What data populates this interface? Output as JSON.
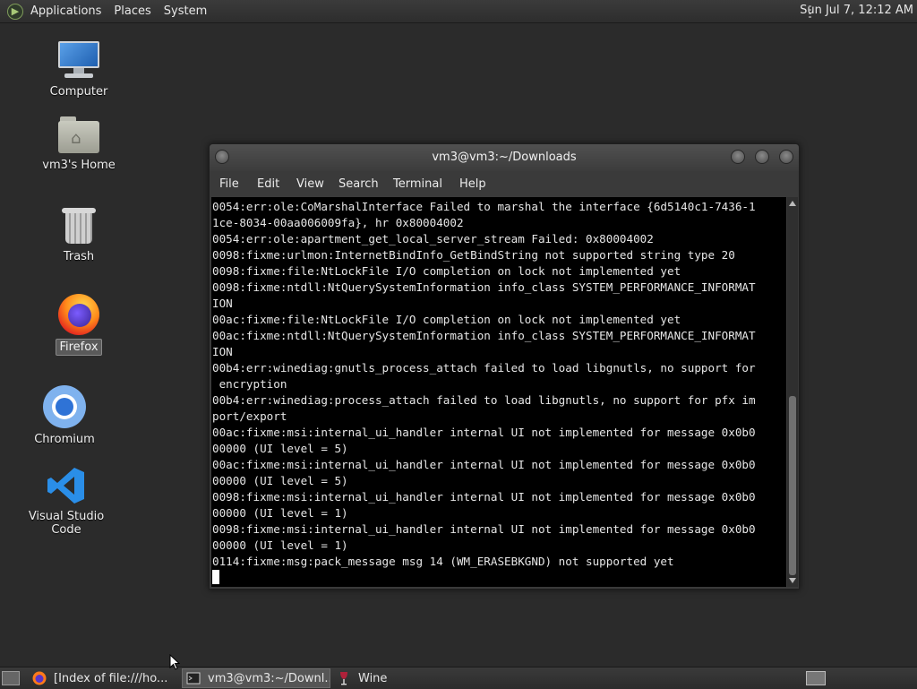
{
  "top_panel": {
    "menus": [
      "Applications",
      "Places",
      "System"
    ],
    "clock": "Sun Jul  7, 12:12 AM"
  },
  "desktop": {
    "icons": [
      {
        "label": "Computer",
        "icon": "computer-icon"
      },
      {
        "label": "vm3's Home",
        "icon": "home-folder-icon"
      },
      {
        "label": "Trash",
        "icon": "trash-icon"
      },
      {
        "label": "Firefox",
        "icon": "firefox-icon",
        "selected": true
      },
      {
        "label": "Chromium",
        "icon": "chromium-icon"
      },
      {
        "label": "Visual Studio Code",
        "icon": "vscode-icon"
      }
    ]
  },
  "terminal": {
    "title": "vm3@vm3:~/Downloads",
    "menu": [
      "File",
      "Edit",
      "View",
      "Search",
      "Terminal",
      "Help"
    ],
    "lines": [
      "0054:err:ole:CoMarshalInterface Failed to marshal the interface {6d5140c1-7436-1",
      "1ce-8034-00aa006009fa}, hr 0x80004002",
      "0054:err:ole:apartment_get_local_server_stream Failed: 0x80004002",
      "0098:fixme:urlmon:InternetBindInfo_GetBindString not supported string type 20",
      "0098:fixme:file:NtLockFile I/O completion on lock not implemented yet",
      "0098:fixme:ntdll:NtQuerySystemInformation info_class SYSTEM_PERFORMANCE_INFORMAT",
      "ION",
      "00ac:fixme:file:NtLockFile I/O completion on lock not implemented yet",
      "00ac:fixme:ntdll:NtQuerySystemInformation info_class SYSTEM_PERFORMANCE_INFORMAT",
      "ION",
      "00b4:err:winediag:gnutls_process_attach failed to load libgnutls, no support for",
      " encryption",
      "00b4:err:winediag:process_attach failed to load libgnutls, no support for pfx im",
      "port/export",
      "00ac:fixme:msi:internal_ui_handler internal UI not implemented for message 0x0b0",
      "00000 (UI level = 5)",
      "00ac:fixme:msi:internal_ui_handler internal UI not implemented for message 0x0b0",
      "00000 (UI level = 5)",
      "0098:fixme:msi:internal_ui_handler internal UI not implemented for message 0x0b0",
      "00000 (UI level = 1)",
      "0098:fixme:msi:internal_ui_handler internal UI not implemented for message 0x0b0",
      "00000 (UI level = 1)",
      "0114:fixme:msg:pack_message msg 14 (WM_ERASEBKGND) not supported yet"
    ]
  },
  "taskbar": {
    "tasks": [
      {
        "label": "[Index of file:///ho...",
        "icon": "firefox-icon",
        "active": false
      },
      {
        "label": "vm3@vm3:~/Downl...",
        "icon": "terminal-icon",
        "active": true
      },
      {
        "label": "Wine",
        "icon": "wine-glass-icon",
        "active": false
      }
    ]
  }
}
